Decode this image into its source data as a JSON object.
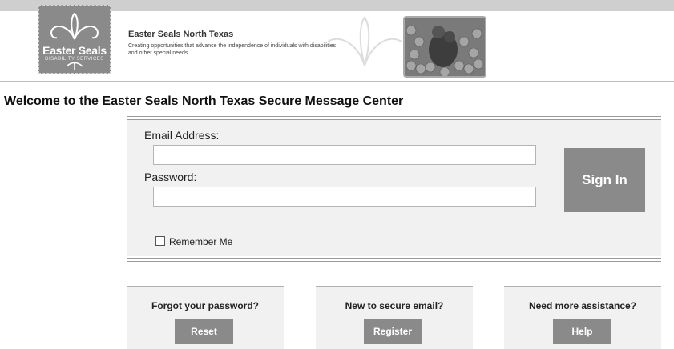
{
  "header": {
    "logo_text": "Easter Seals",
    "logo_sub": "DISABILITY SERVICES",
    "org_name": "Easter Seals North Texas",
    "tagline": "Creating opportunities that advance the independence of individuals with disabilities and other special needs."
  },
  "welcome": "Welcome to the Easter Seals North Texas Secure Message Center",
  "form": {
    "email_label": "Email Address:",
    "email_value": "",
    "password_label": "Password:",
    "password_value": "",
    "signin_label": "Sign In",
    "remember_label": "Remember Me",
    "remember_checked": false
  },
  "cards": [
    {
      "title": "Forgot your password?",
      "button": "Reset"
    },
    {
      "title": "New to secure email?",
      "button": "Register"
    },
    {
      "title": "Need more assistance?",
      "button": "Help"
    }
  ],
  "colors": {
    "button": "#8a8a8a",
    "panel": "#f1f1f1"
  }
}
